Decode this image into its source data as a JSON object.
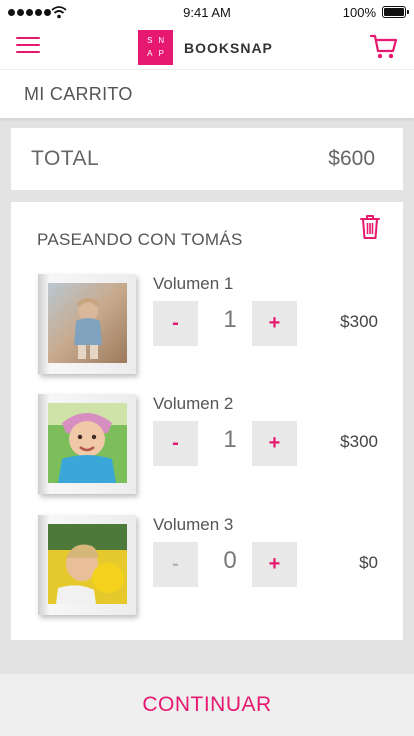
{
  "status_bar": {
    "time": "9:41 AM",
    "battery": "100%"
  },
  "header": {
    "logo_letters": [
      "S",
      "N",
      "A",
      "P"
    ],
    "brand": "BOOKSNAP"
  },
  "page_title": "MI CARRITO",
  "total": {
    "label": "TOTAL",
    "amount": "$600"
  },
  "book": {
    "title": "PASEANDO CON TOMÁS",
    "items": [
      {
        "volume": "Volumen 1",
        "minus": "-",
        "quantity": "1",
        "plus": "+",
        "price": "$300"
      },
      {
        "volume": "Volumen 2",
        "minus": "-",
        "quantity": "1",
        "plus": "+",
        "price": "$300"
      },
      {
        "volume": "Volumen 3",
        "minus": "-",
        "quantity": "0",
        "plus": "+",
        "price": "$0"
      }
    ]
  },
  "continue_label": "CONTINUAR",
  "colors": {
    "accent": "#e6186f",
    "background": "#e3e3e3",
    "button_bg": "#e8e8e8"
  },
  "icons": [
    "signal-icon",
    "wifi-icon",
    "battery-icon",
    "menu-icon",
    "cart-icon",
    "trash-icon"
  ]
}
